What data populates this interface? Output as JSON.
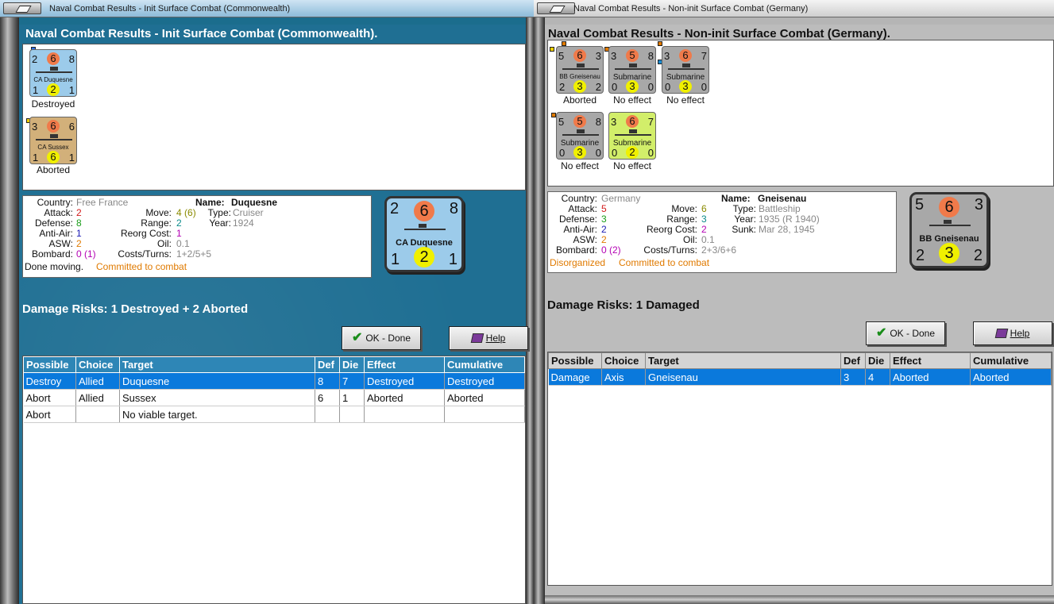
{
  "left": {
    "window_title": "Naval Combat Results - Init Surface Combat (Commonwealth)",
    "heading": "Naval Combat Results - Init Surface Combat (Commonwealth).",
    "units": [
      {
        "name": "CA Duquesne",
        "tl": "2",
        "top": "6",
        "tr": "8",
        "bl": "1",
        "bot": "2",
        "br": "1",
        "result": "Destroyed",
        "color": "#9ccbea"
      },
      {
        "name": "CA Sussex",
        "tl": "3",
        "top": "6",
        "tr": "6",
        "bl": "1",
        "bot": "6",
        "br": "1",
        "result": "Aborted",
        "color": "#d2b07a"
      }
    ],
    "info": {
      "country_label": "Country:",
      "country": "Free France",
      "attack_label": "Attack:",
      "attack": "2",
      "defense_label": "Defense:",
      "defense": "8",
      "antiair_label": "Anti-Air:",
      "antiair": "1",
      "asw_label": "ASW:",
      "asw": "2",
      "bombard_label": "Bombard:",
      "bombard": "0 (1)",
      "move_label": "Move:",
      "move": "4",
      "move_extra": "(6)",
      "range_label": "Range:",
      "range": "2",
      "reorg_label": "Reorg Cost:",
      "reorg": "1",
      "oil_label": "Oil:",
      "oil": "0.1",
      "costs_label": "Costs/Turns:",
      "costs": "1+2/5+5",
      "name_label": "Name:",
      "name": "Duquesne",
      "type_label": "Type:",
      "type": "Cruiser",
      "year_label": "Year:",
      "year": "1924",
      "status1": "Done moving.",
      "status2": "Committed to combat"
    },
    "big_counter": {
      "name": "CA Duquesne",
      "tl": "2",
      "top": "6",
      "tr": "8",
      "bl": "1",
      "bot": "2",
      "br": "1",
      "color": "#9ccbea"
    },
    "damage": "Damage Risks:  1 Destroyed + 2 Aborted",
    "ok_label": "OK - Done",
    "help_label": "Help",
    "columns": [
      "Possible",
      "Choice",
      "Target",
      "Def",
      "Die",
      "Effect",
      "Cumulative"
    ],
    "rows": [
      [
        "Destroy",
        "Allied",
        "Duquesne",
        "8",
        "7",
        "Destroyed",
        "Destroyed"
      ],
      [
        "Abort",
        "Allied",
        "Sussex",
        "6",
        "1",
        "Aborted",
        "Aborted"
      ],
      [
        "Abort",
        "",
        "No viable target.",
        "",
        "",
        "",
        ""
      ]
    ]
  },
  "right": {
    "window_title": "Naval Combat Results - Non-init Surface Combat (Germany)",
    "heading": "Naval Combat Results - Non-init Surface Combat (Germany).",
    "units": [
      {
        "name": "BB Gneisenau",
        "tl": "5",
        "top": "6",
        "tr": "3",
        "bl": "2",
        "bot": "3",
        "br": "2",
        "result": "Aborted",
        "color": "#a8a8a8"
      },
      {
        "name": "Submarine",
        "tl": "3",
        "top": "5",
        "tr": "8",
        "bl": "0",
        "bot": "3",
        "br": "0",
        "result": "No effect",
        "color": "#a8a8a8"
      },
      {
        "name": "Submarine",
        "tl": "3",
        "top": "6",
        "tr": "7",
        "bl": "0",
        "bot": "3",
        "br": "0",
        "result": "No effect",
        "color": "#a8a8a8"
      },
      {
        "name": "Submarine",
        "tl": "5",
        "top": "5",
        "tr": "8",
        "bl": "0",
        "bot": "3",
        "br": "0",
        "result": "No effect",
        "color": "#a8a8a8"
      },
      {
        "name": "Submarine",
        "tl": "3",
        "top": "6",
        "tr": "7",
        "bl": "0",
        "bot": "2",
        "br": "0",
        "result": "No effect",
        "color": "#d2ee6a"
      }
    ],
    "info": {
      "country_label": "Country:",
      "country": "Germany",
      "attack_label": "Attack:",
      "attack": "5",
      "defense_label": "Defense:",
      "defense": "3",
      "antiair_label": "Anti-Air:",
      "antiair": "2",
      "asw_label": "ASW:",
      "asw": "2",
      "bombard_label": "Bombard:",
      "bombard": "0 (2)",
      "move_label": "Move:",
      "move": "6",
      "range_label": "Range:",
      "range": "3",
      "reorg_label": "Reorg Cost:",
      "reorg": "2",
      "oil_label": "Oil:",
      "oil": "0.1",
      "costs_label": "Costs/Turns:",
      "costs": "2+3/6+6",
      "name_label": "Name:",
      "name": "Gneisenau",
      "type_label": "Type:",
      "type": "Battleship",
      "year_label": "Year:",
      "year": "1935 (R 1940)",
      "sunk_label": "Sunk:",
      "sunk": "Mar 28, 1945",
      "status1": "Disorganized",
      "status2": "Committed to combat"
    },
    "big_counter": {
      "name": "BB Gneisenau",
      "tl": "5",
      "top": "6",
      "tr": "3",
      "bl": "2",
      "bot": "3",
      "br": "2",
      "color": "#a8a8a8"
    },
    "damage": "Damage Risks:  1 Damaged",
    "ok_label": "OK - Done",
    "help_label": "Help",
    "columns": [
      "Possible",
      "Choice",
      "Target",
      "Def",
      "Die",
      "Effect",
      "Cumulative"
    ],
    "rows": [
      [
        "Damage",
        "Axis",
        "Gneisenau",
        "3",
        "4",
        "Aborted",
        "Aborted"
      ]
    ]
  }
}
